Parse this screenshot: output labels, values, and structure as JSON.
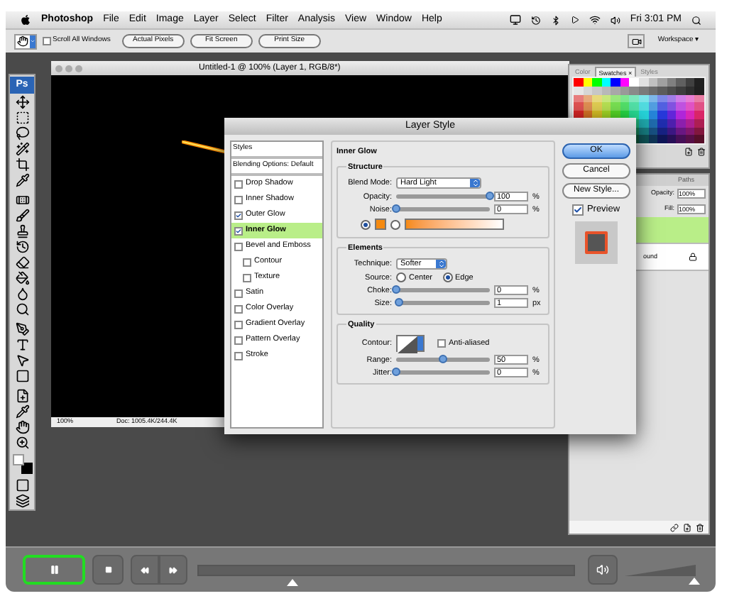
{
  "menu_bar": {
    "app": "Photoshop",
    "items": [
      "File",
      "Edit",
      "Image",
      "Layer",
      "Select",
      "Filter",
      "Analysis",
      "View",
      "Window",
      "Help"
    ],
    "clock": "Fri 3:01 PM"
  },
  "options_bar": {
    "scroll_all_windows": {
      "label": "Scroll All Windows",
      "checked": false
    },
    "buttons": [
      "Actual Pixels",
      "Fit Screen",
      "Print Size"
    ],
    "workspace": "Workspace ▾"
  },
  "tools_panel": {
    "logo": "Ps"
  },
  "document": {
    "title": "Untitled-1 @ 100% (Layer 1, RGB/8*)",
    "zoom": "100%",
    "doc_info": "Doc: 1005.4K/244.4K"
  },
  "swatches_panel": {
    "tabs": [
      {
        "label": "Color",
        "selected": false
      },
      {
        "label": "Swatches ×",
        "selected": true
      },
      {
        "label": "Styles",
        "selected": false
      }
    ]
  },
  "layers_panel": {
    "tabs": [
      {
        "label": "Paths",
        "selected": false
      }
    ],
    "opacity_label": "Opacity:",
    "opacity": "100%",
    "fill_label": "Fill:",
    "fill": "100%",
    "layers": [
      {
        "selected": true,
        "locked": false
      },
      {
        "name": "ound",
        "selected": false,
        "locked": true
      }
    ]
  },
  "dialog": {
    "title": "Layer Style",
    "styles_list": [
      {
        "kind": "header",
        "label": "Styles"
      },
      {
        "kind": "header",
        "label": "Blending Options: Default"
      },
      {
        "kind": "effect",
        "label": "Drop Shadow",
        "checked": false,
        "selected": false
      },
      {
        "kind": "effect",
        "label": "Inner Shadow",
        "checked": false,
        "selected": false
      },
      {
        "kind": "effect",
        "label": "Outer Glow",
        "checked": true,
        "selected": false
      },
      {
        "kind": "effect",
        "label": "Inner Glow",
        "checked": true,
        "selected": true
      },
      {
        "kind": "effect",
        "label": "Bevel and Emboss",
        "checked": false,
        "selected": false,
        "children": [
          {
            "kind": "effect",
            "label": "Contour",
            "checked": false,
            "selected": false
          },
          {
            "kind": "effect",
            "label": "Texture",
            "checked": false,
            "selected": false
          }
        ]
      },
      {
        "kind": "effect",
        "label": "Satin",
        "checked": false,
        "selected": false
      },
      {
        "kind": "effect",
        "label": "Color Overlay",
        "checked": false,
        "selected": false
      },
      {
        "kind": "effect",
        "label": "Gradient Overlay",
        "checked": false,
        "selected": false
      },
      {
        "kind": "effect",
        "label": "Pattern Overlay",
        "checked": false,
        "selected": false
      },
      {
        "kind": "effect",
        "label": "Stroke",
        "checked": false,
        "selected": false
      }
    ],
    "section_title": "Inner Glow",
    "structure": {
      "title": "Structure",
      "blend_mode_label": "Blend Mode:",
      "blend_mode": "Hard Light",
      "sliders": [
        {
          "label": "Opacity:",
          "value": "100",
          "unit": "%",
          "level": 1
        },
        {
          "label": "Noise:",
          "value": "0",
          "unit": "%",
          "level": 0
        }
      ],
      "fill_options": [
        {
          "kind": "color",
          "selected": true
        },
        {
          "kind": "gradient",
          "selected": false
        }
      ]
    },
    "elements": {
      "title": "Elements",
      "technique_label": "Technique:",
      "technique": "Softer",
      "source_label": "Source:",
      "sources": [
        {
          "label": "Center",
          "selected": false
        },
        {
          "label": "Edge",
          "selected": true
        }
      ],
      "sliders": [
        {
          "label": "Choke:",
          "value": "0",
          "unit": "%",
          "level": 0
        },
        {
          "label": "Size:",
          "value": "1",
          "unit": "px",
          "level": 0.03
        }
      ]
    },
    "quality": {
      "title": "Quality",
      "contour_label": "Contour:",
      "anti_aliased": {
        "label": "Anti-aliased",
        "checked": false
      },
      "sliders": [
        {
          "label": "Range:",
          "value": "50",
          "unit": "%",
          "level": 0.5
        },
        {
          "label": "Jitter:",
          "value": "0",
          "unit": "%",
          "level": 0
        }
      ]
    },
    "buttons": [
      {
        "label": "OK",
        "default": true
      },
      {
        "label": "Cancel",
        "default": false
      },
      {
        "label": "New Style...",
        "default": false
      }
    ],
    "preview": {
      "label": "Preview",
      "checked": true
    }
  },
  "player": {
    "playing": true,
    "progress": {
      "level": 0.25
    },
    "volume": {
      "level": 0.97
    }
  }
}
